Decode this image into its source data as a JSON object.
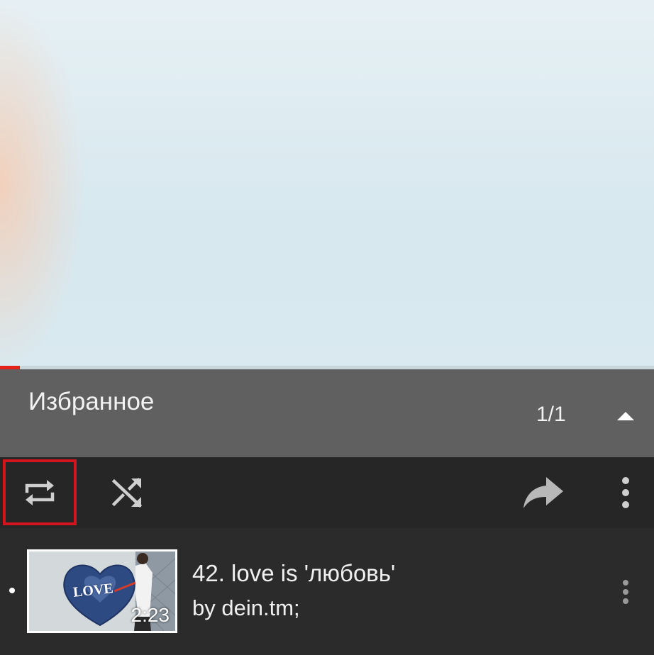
{
  "player": {
    "progress_fraction": 0.03
  },
  "playlist": {
    "title": "Избранное",
    "count": "1/1",
    "collapse_icon": "chevron-up-icon"
  },
  "toolbar": {
    "loop_icon": "loop-icon",
    "shuffle_icon": "shuffle-icon",
    "share_icon": "share-icon",
    "more_icon": "more-vert-icon",
    "highlight_color": "#d4151e"
  },
  "items": [
    {
      "title": "42. love is 'любовь'",
      "author": "by dein.tm;",
      "duration": "2:23",
      "thumbnail_text": "LOVE",
      "is_current": true
    }
  ],
  "colors": {
    "header_bg": "#606060",
    "toolbar_bg": "#262626",
    "list_bg": "#2b2b2b",
    "accent_red": "#e62117"
  }
}
